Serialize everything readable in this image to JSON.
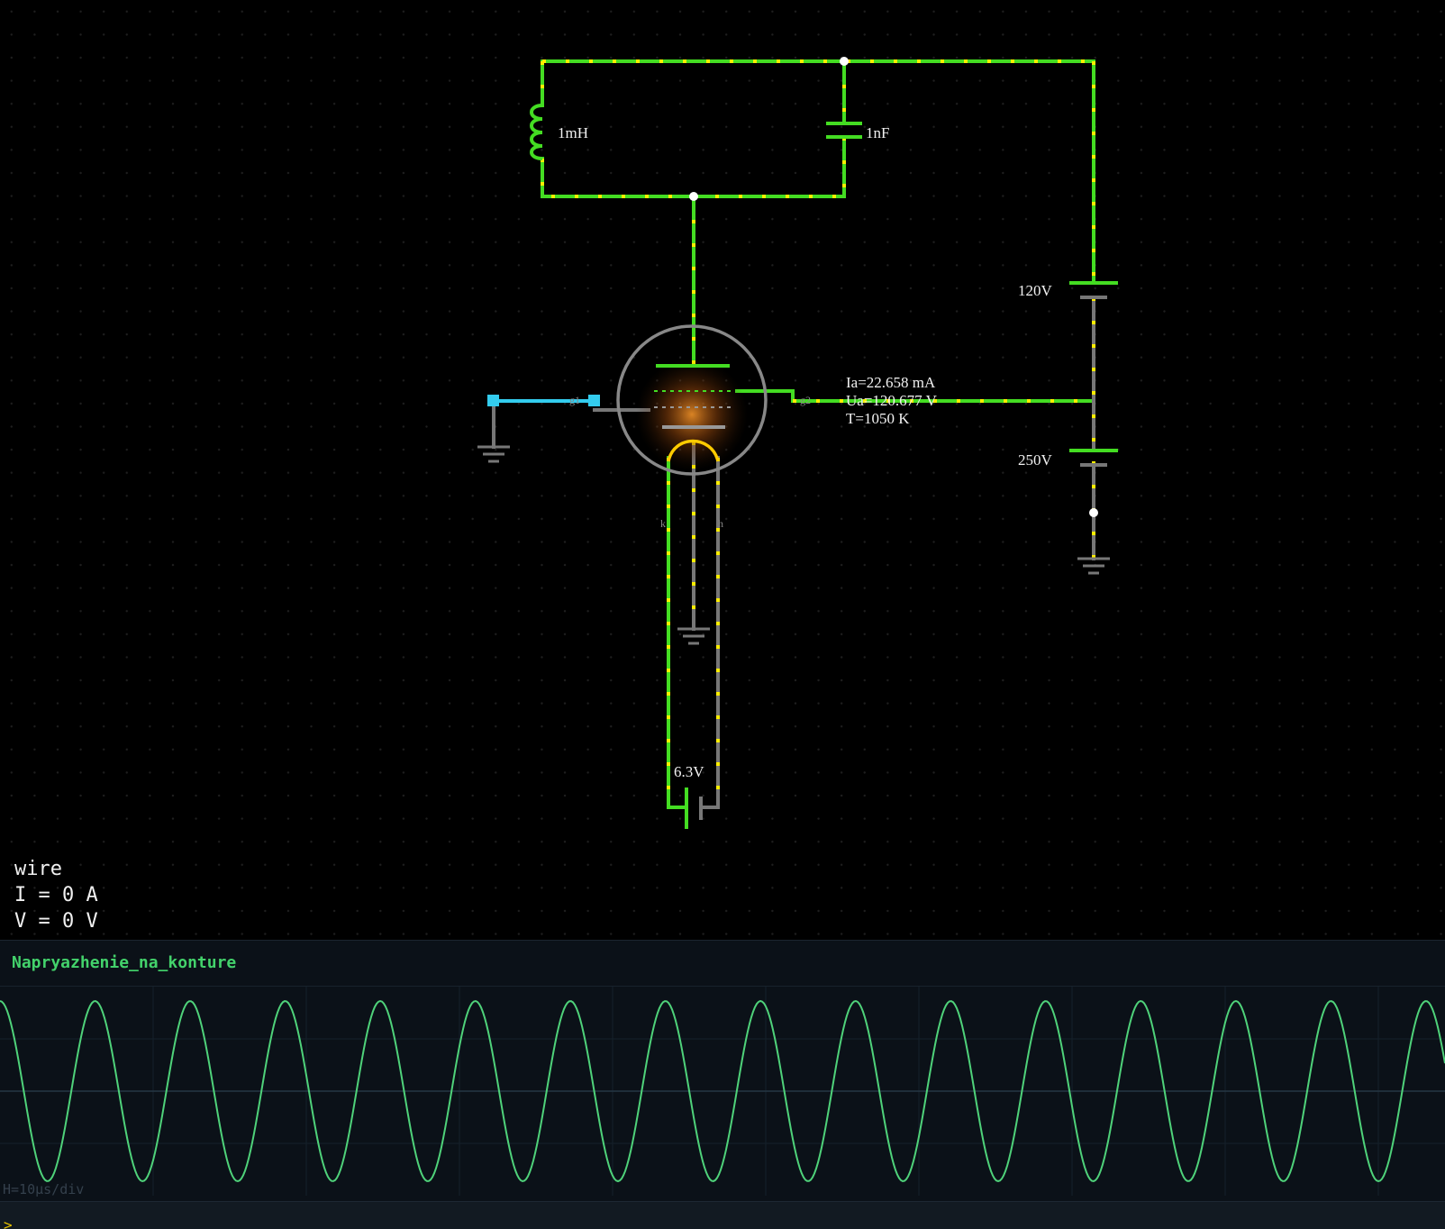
{
  "circuit": {
    "inductor_label": "1mH",
    "capacitor_label": "1nF",
    "battery_plate_label": "120V",
    "battery_grid_label": "250V",
    "battery_heater_label": "6.3V",
    "tube_readout": {
      "ia": "Ia=22.658 mA",
      "ua": "Ua=120.677 V",
      "temp": "T=1050 K"
    },
    "pin_labels": {
      "g1": "g1",
      "g2": "g2",
      "k": "k",
      "h1": "h",
      "h2": "h"
    },
    "colors": {
      "active_wire": "#44dd22",
      "inactive_wire": "#777777",
      "selected_wire": "#33ccee",
      "current_dots": "#ffee00"
    }
  },
  "info_panel": {
    "type": "wire",
    "current": "I = 0 A",
    "voltage": "V = 0 V"
  },
  "scope": {
    "title": "Napryazhenie_na_konture",
    "scale_label": "H=10µs/div",
    "trace_color": "#4fd27a",
    "cycles_visible": 15.2
  },
  "bottom_bar": {
    "prompt": ">"
  }
}
